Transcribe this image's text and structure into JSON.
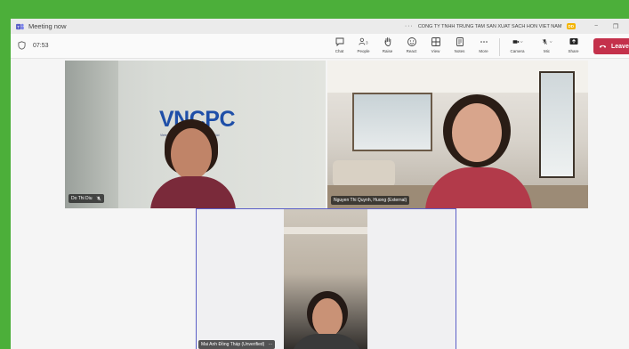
{
  "window": {
    "title": "Meeting now"
  },
  "titlebar": {
    "more_label": "···",
    "org_name": "CONG TY TNHH TRUNG TAM SAN XUAT SACH HON VIET NAM",
    "org_badge": "DD",
    "minimize": "−",
    "restore": "❐"
  },
  "meeting": {
    "elapsed": "07:53"
  },
  "toolbar": {
    "items": [
      {
        "label": "Chat"
      },
      {
        "label": "People",
        "count": "3"
      },
      {
        "label": "Raise"
      },
      {
        "label": "React"
      },
      {
        "label": "View"
      },
      {
        "label": "Notes"
      },
      {
        "label": "More"
      }
    ],
    "camera_label": "Camera",
    "mic_label": "Mic",
    "share_label": "Share",
    "leave_label": "Leave"
  },
  "participants": [
    {
      "name": "Do Thi Diu",
      "logo_text": "VNCPC",
      "logo_sub": "Vietnam Cleaner Production Centre Co Ltd"
    },
    {
      "name": "Nguyen Thi Quynh, Huong (External)"
    },
    {
      "name": "Mai Anh Đồng Tháp (Unverified)",
      "more": "···"
    }
  ],
  "colors": {
    "accent": "#c4314b",
    "frame": "#4caf3a",
    "active_speaker": "#5b5fc7"
  }
}
